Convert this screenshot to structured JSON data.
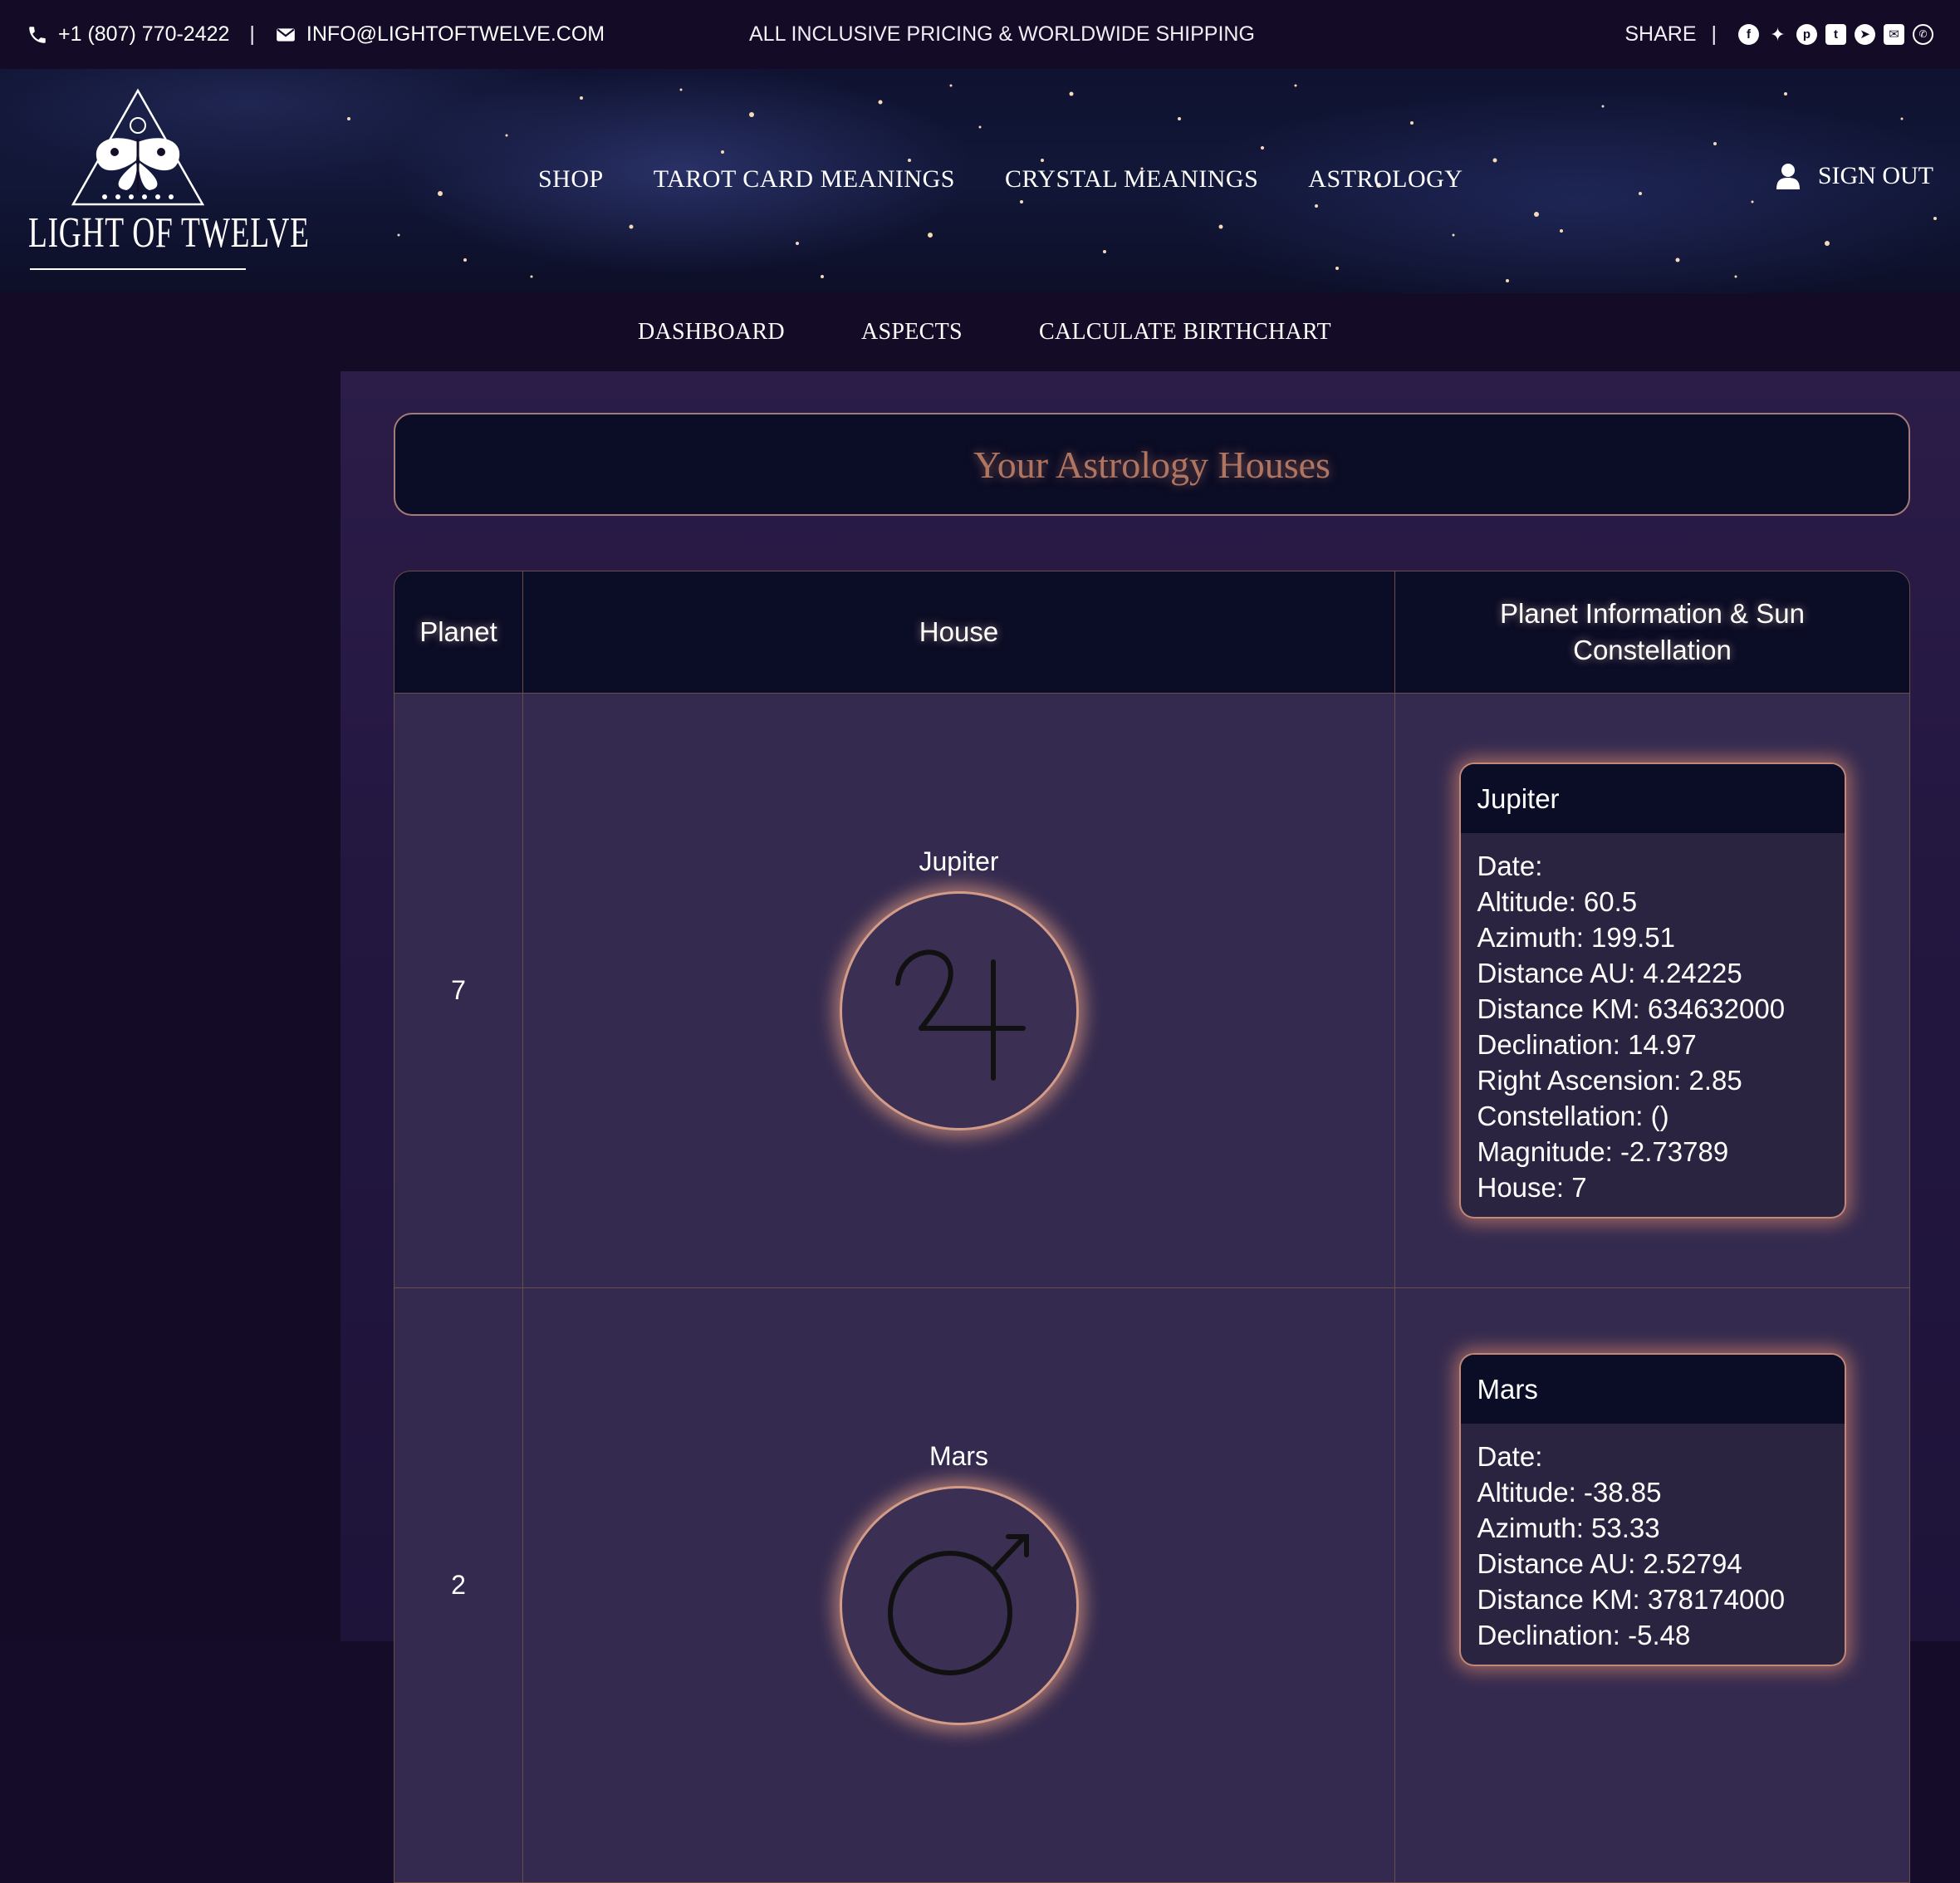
{
  "topbar": {
    "phone": "+1 (807) 770-2422",
    "separator": "|",
    "email": "INFO@LIGHTOFTWELVE.COM",
    "promo": "ALL INCLUSIVE PRICING & WORLDWIDE SHIPPING",
    "share_label": "SHARE",
    "share_sep": "|",
    "share_icons": [
      "facebook-icon",
      "twitter-icon",
      "pinterest-icon",
      "tumblr-icon",
      "telegram-icon",
      "email-icon",
      "whatsapp-icon"
    ]
  },
  "brand": {
    "name": "LIGHT OF TWELVE"
  },
  "main_nav": [
    "SHOP",
    "TAROT CARD MEANINGS",
    "CRYSTAL MEANINGS",
    "ASTROLOGY"
  ],
  "account": {
    "label": "SIGN OUT",
    "icon": "user-icon"
  },
  "sub_nav": [
    "DASHBOARD",
    "ASPECTS",
    "CALCULATE BIRTHCHART"
  ],
  "page": {
    "title": "Your Astrology Houses"
  },
  "table": {
    "headers": [
      "Planet",
      "House",
      "Planet Information & Sun Constellation"
    ],
    "rows": [
      {
        "house": "7",
        "planet": "Jupiter",
        "symbol_icon": "jupiter-symbol-icon",
        "info_title": "Jupiter",
        "info": [
          "Date:",
          "Altitude: 60.5",
          "Azimuth: 199.51",
          "Distance AU: 4.24225",
          "Distance KM: 634632000",
          "Declination: 14.97",
          "Right Ascension: 2.85",
          "Constellation: ()",
          "Magnitude: -2.73789",
          "House: 7"
        ]
      },
      {
        "house": "2",
        "planet": "Mars",
        "symbol_icon": "mars-symbol-icon",
        "info_title": "Mars",
        "info": [
          "Date:",
          "Altitude: -38.85",
          "Azimuth: 53.33",
          "Distance AU: 2.52794",
          "Distance KM: 378174000",
          "Declination: -5.48"
        ]
      }
    ]
  },
  "colors": {
    "page_bg": "#140b26",
    "panel_bg": "#0b0c25",
    "cell_bg": "#342a4f",
    "glow": "#e8a582",
    "title_text": "#b07561",
    "border": "#6a4e4c"
  }
}
